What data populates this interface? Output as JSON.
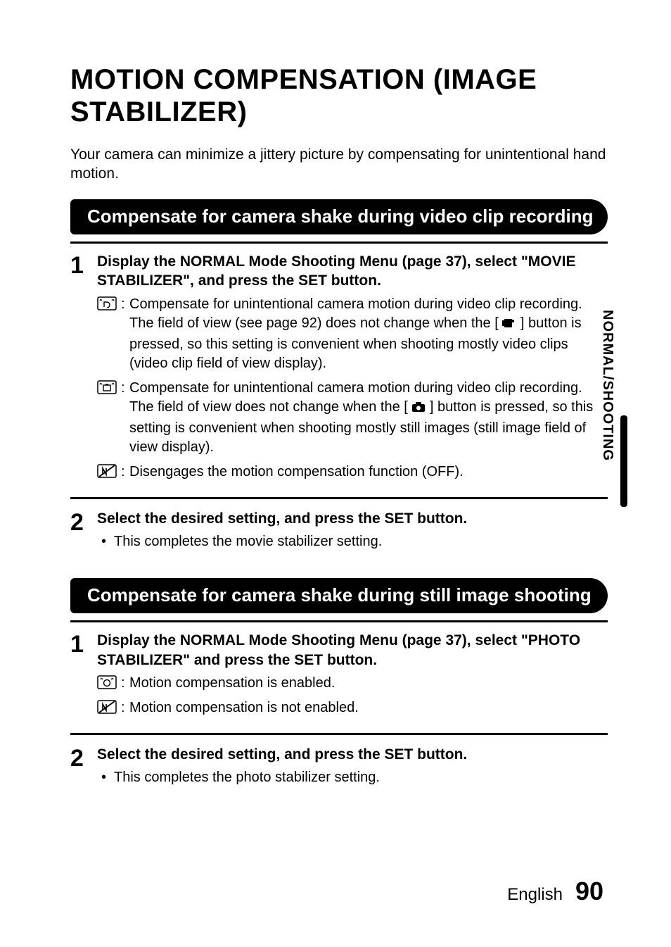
{
  "title": "MOTION COMPENSATION (IMAGE STABILIZER)",
  "intro": "Your camera can minimize a jittery picture by compensating for unintentional hand motion.",
  "side_tab": "NORMAL/SHOOTING",
  "footer": {
    "lang": "English",
    "page": "90"
  },
  "section1": {
    "heading": "Compensate for camera shake during video clip recording",
    "step1": {
      "num": "1",
      "head": "Display the NORMAL Mode Shooting Menu (page 37), select \"MOVIE STABILIZER\", and press the SET button.",
      "optA_pre": "Compensate for unintentional camera motion during video clip recording. The field of view (see page 92) does not change when the [ ",
      "optA_post": " ] button is pressed, so this setting is convenient when shooting mostly video clips (video clip field of view display).",
      "optB_pre": "Compensate for unintentional camera motion during video clip recording. The field of view does not change when the [ ",
      "optB_post": " ] button is pressed, so this setting is convenient when shooting mostly still images (still image field of view display).",
      "optC": "Disengages the motion compensation function (OFF)."
    },
    "step2": {
      "num": "2",
      "head": "Select the desired setting, and press the SET button.",
      "bullet": "This completes the movie stabilizer setting."
    }
  },
  "section2": {
    "heading": "Compensate for camera shake during still image shooting",
    "step1": {
      "num": "1",
      "head": "Display the NORMAL Mode Shooting Menu (page 37), select \"PHOTO STABILIZER\" and press the SET button.",
      "optA": "Motion compensation is enabled.",
      "optB": "Motion compensation is not enabled."
    },
    "step2": {
      "num": "2",
      "head": "Select the desired setting, and press the SET button.",
      "bullet": "This completes the photo stabilizer setting."
    }
  },
  "icons": {
    "stab_video": "stabilizer-video-icon",
    "stab_still": "stabilizer-still-icon",
    "stab_off": "stabilizer-off-icon",
    "stab_on_photo": "stabilizer-photo-on-icon",
    "stab_off_photo": "stabilizer-photo-off-icon",
    "video_button": "video-button-icon",
    "camera_button": "camera-button-icon"
  }
}
